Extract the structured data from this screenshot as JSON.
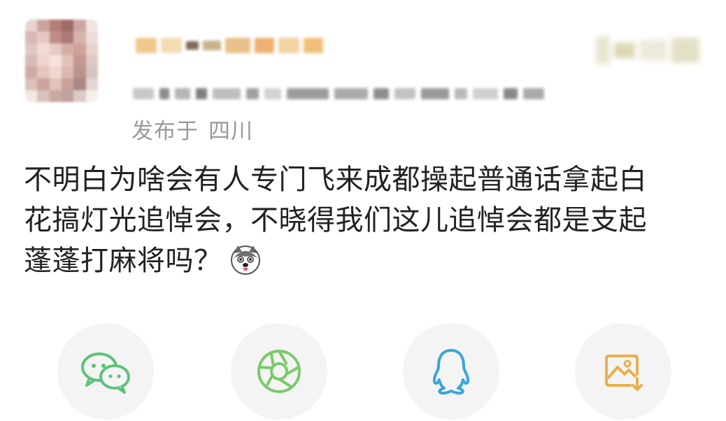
{
  "post": {
    "location_label": "发布于",
    "location_value": "四川",
    "content_lines": [
      "不明白为啥会有人专门飞来成都操起普通话拿起白",
      "花搞灯光追悼会，不晓得我们这儿追悼会都是支起",
      "蓬蓬打麻将吗？"
    ],
    "emoji": "husky-dog-emoji"
  },
  "share": {
    "items": [
      {
        "name": "wechat",
        "icon": "wechat-icon",
        "color": "#5ec27a"
      },
      {
        "name": "moments",
        "icon": "moments-icon",
        "color": "#7ac96b"
      },
      {
        "name": "qq",
        "icon": "qq-icon",
        "color": "#3aa5d8"
      },
      {
        "name": "save-image",
        "icon": "save-image-icon",
        "color": "#e8b04a"
      }
    ]
  },
  "colors": {
    "text": "#222222",
    "meta_text": "#9a9a9a",
    "share_bg": "#f4f4f4"
  }
}
